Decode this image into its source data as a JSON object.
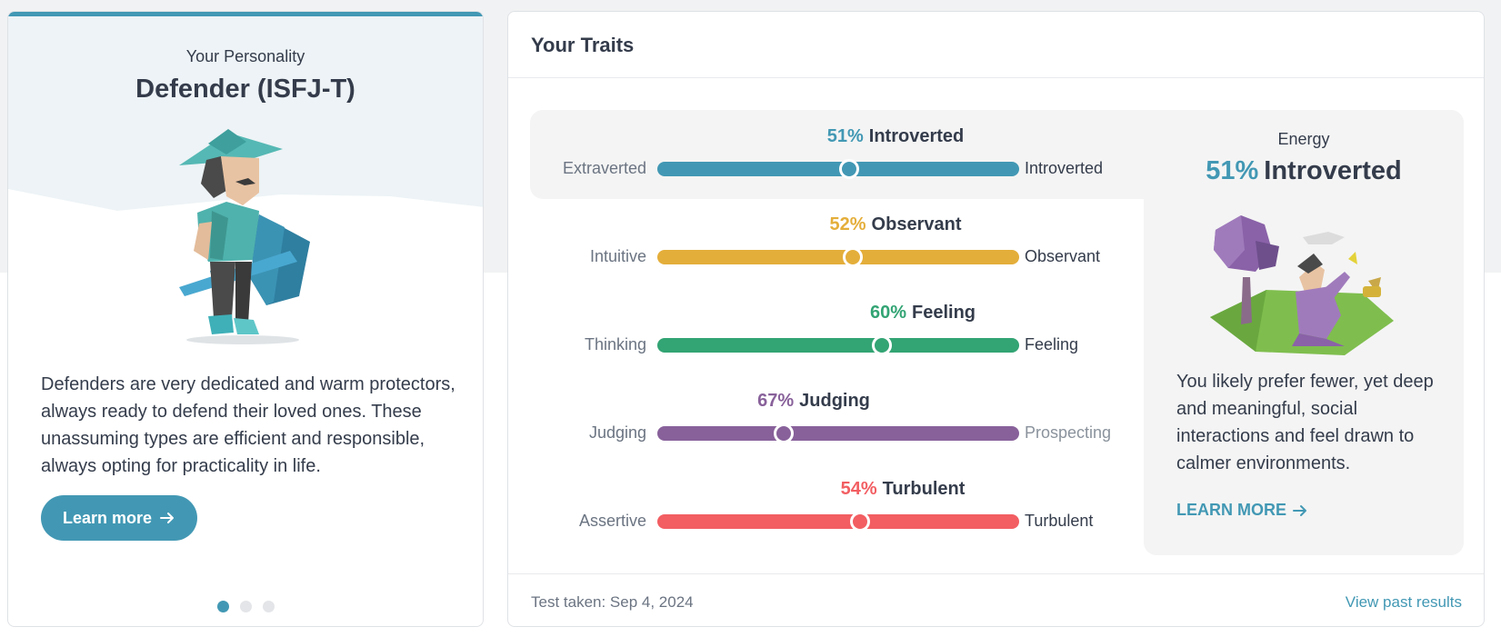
{
  "colors": {
    "energy": "#4298b4",
    "mind": "#e4ae3a",
    "nature": "#33a474",
    "tactics": "#88619a",
    "identity": "#f25e62"
  },
  "personality": {
    "eyebrow": "Your Personality",
    "type_title": "Defender (ISFJ-T)",
    "description": "Defenders are very dedicated and warm protectors, always ready to defend their loved ones. These unassuming types are efficient and responsible, always opting for practicality in life.",
    "learn_more_label": "Learn more",
    "pagination": {
      "total": 3,
      "active": 1
    }
  },
  "traits": {
    "title": "Your Traits",
    "rows": [
      {
        "percent": "51%",
        "name": "Introverted",
        "left": "Extraverted",
        "right": "Introverted",
        "position": 0.51,
        "color": "#4298b4"
      },
      {
        "percent": "52%",
        "name": "Observant",
        "left": "Intuitive",
        "right": "Observant",
        "position": 0.52,
        "color": "#e4ae3a"
      },
      {
        "percent": "60%",
        "name": "Feeling",
        "left": "Thinking",
        "right": "Feeling",
        "position": 0.6,
        "color": "#33a474"
      },
      {
        "percent": "67%",
        "name": "Judging",
        "left": "Judging",
        "right": "Prospecting",
        "position": 0.33,
        "color": "#88619a"
      },
      {
        "percent": "54%",
        "name": "Turbulent",
        "left": "Assertive",
        "right": "Turbulent",
        "position": 0.54,
        "color": "#f25e62"
      }
    ],
    "detail": {
      "label": "Energy",
      "percent": "51%",
      "name": "Introverted",
      "text": "You likely prefer fewer, yet deep and meaningful, social interactions and feel drawn to calmer environments.",
      "link_label": "LEARN MORE"
    },
    "footer": {
      "test_taken": "Test taken: Sep 4, 2024",
      "view_past": "View past results"
    }
  }
}
